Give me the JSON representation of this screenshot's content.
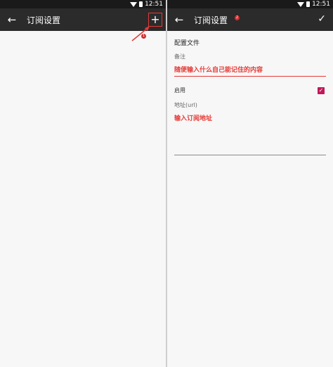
{
  "statusbar": {
    "time": "12:51"
  },
  "left": {
    "back_icon": "←",
    "title": "订阅设置",
    "add_icon": "+",
    "annotation_badge": "1"
  },
  "right": {
    "back_icon": "←",
    "title": "订阅设置",
    "title_badge": "2",
    "save_icon": "✓",
    "section_title": "配置文件",
    "note_label": "备注",
    "note_value": "随便输入什么自己能记住的内容",
    "enable_label": "启用",
    "enable_checked": true,
    "url_label": "地址(url)",
    "url_value": "输入订阅地址"
  },
  "colors": {
    "accent": "#e53935",
    "checkbox": "#c2185b",
    "appbar": "#2b2b2b"
  }
}
